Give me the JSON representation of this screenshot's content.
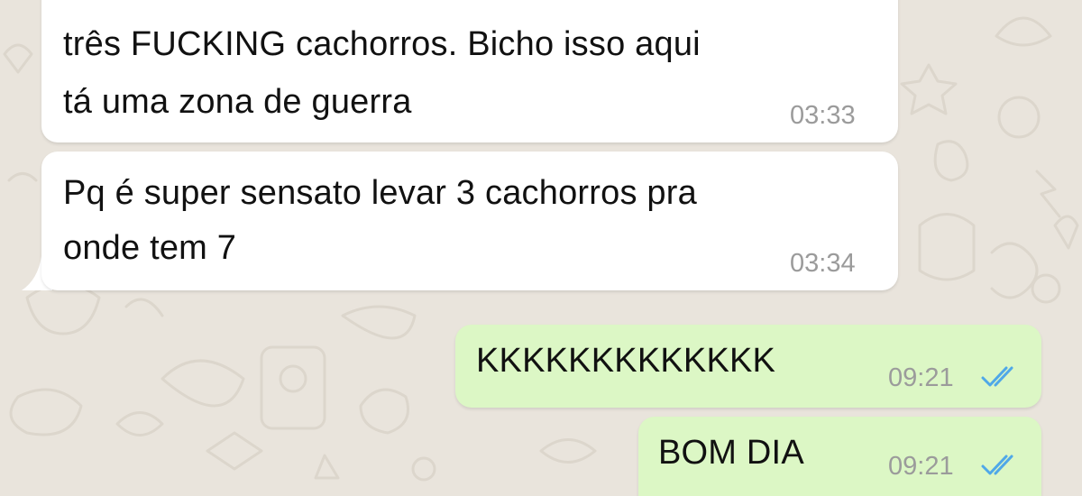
{
  "messages": [
    {
      "direction": "incoming",
      "lines": [
        "três FUCKING cachorros. Bicho isso aqui",
        "tá uma zona de guerra"
      ],
      "time": "03:33"
    },
    {
      "direction": "incoming",
      "lines": [
        "Pq é super sensato levar 3 cachorros pra",
        "onde tem 7"
      ],
      "time": "03:34"
    },
    {
      "direction": "outgoing",
      "lines": [
        "KKKKKKKKKKKKK"
      ],
      "time": "09:21",
      "status": "read"
    },
    {
      "direction": "outgoing",
      "lines": [
        "BOM DIA"
      ],
      "time": "09:21",
      "status": "read"
    }
  ],
  "colors": {
    "wallpaper": "#e9e4dc",
    "incoming_bubble": "#ffffff",
    "outgoing_bubble": "#dcf7c5",
    "timestamp": "#9b9b9b",
    "read_ticks": "#4fa8e8"
  },
  "icons": {
    "read_receipt": "double-check-icon"
  }
}
